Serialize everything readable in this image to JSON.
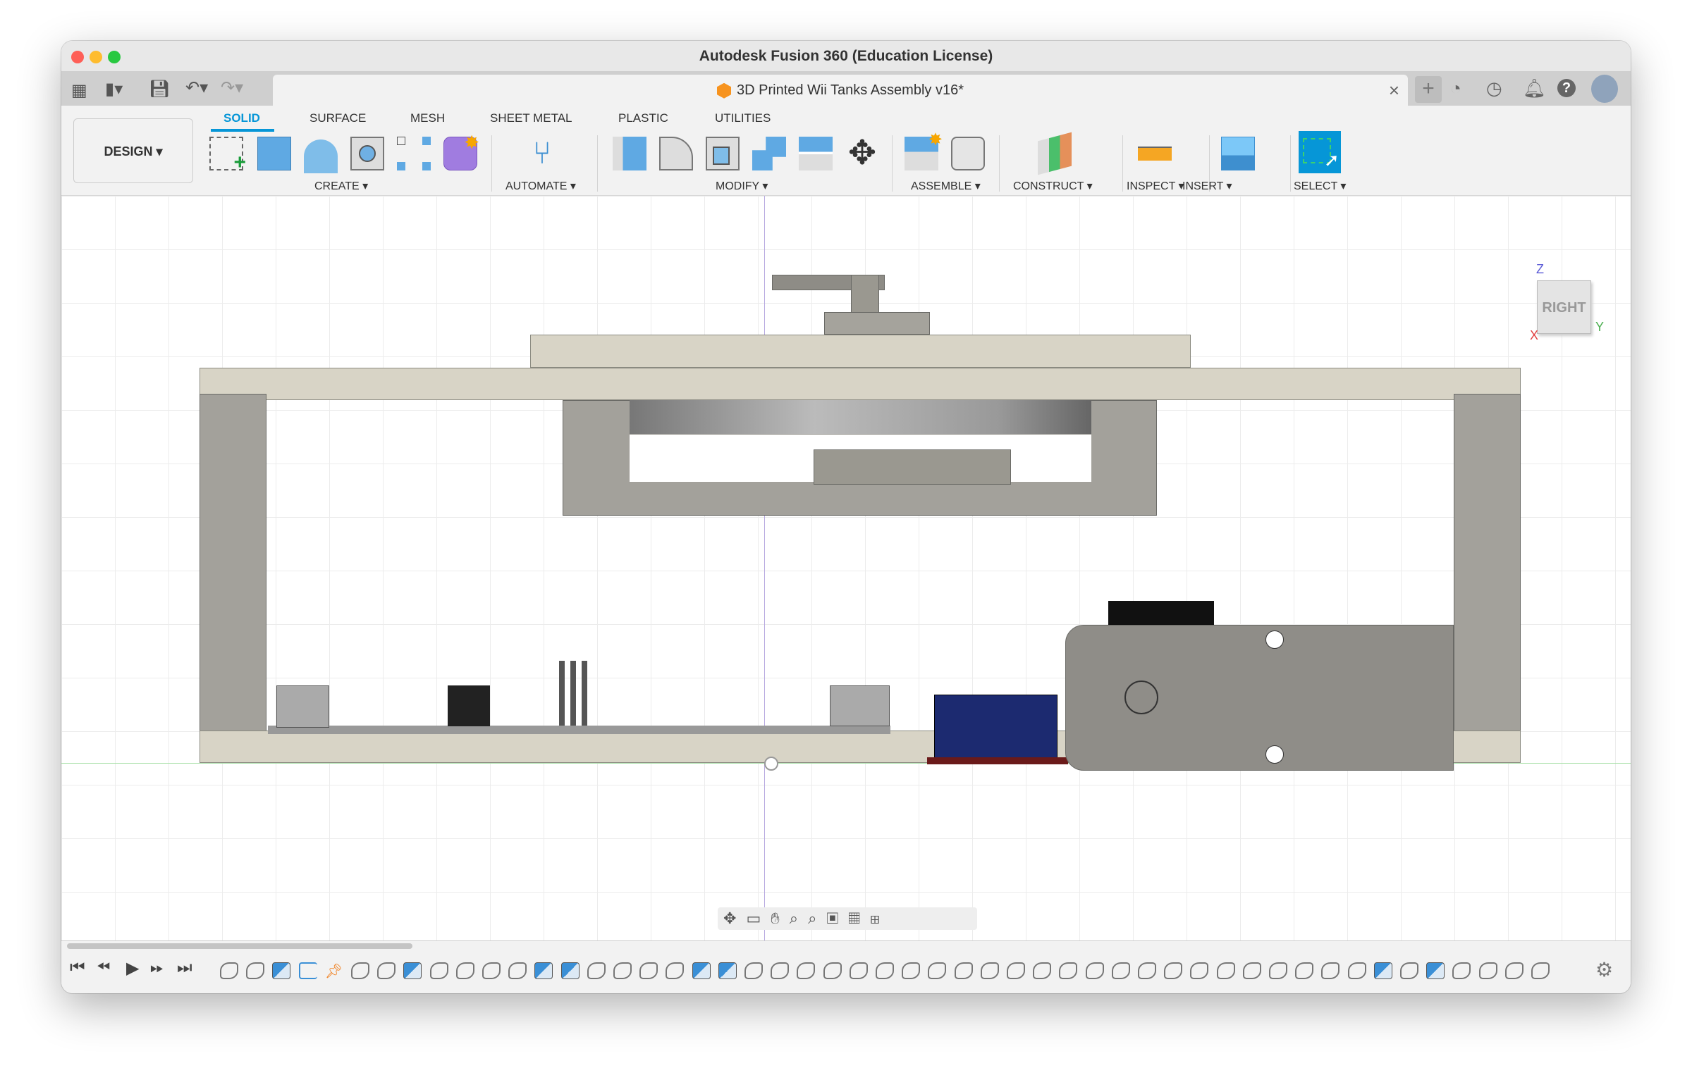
{
  "window": {
    "title": "Autodesk Fusion 360 (Education License)"
  },
  "document_tab": {
    "title": "3D Printed Wii Tanks Assembly v16*",
    "close": "×"
  },
  "workspace": {
    "label": "DESIGN ▾"
  },
  "toolbar_tabs": [
    {
      "label": "SOLID",
      "active": true
    },
    {
      "label": "SURFACE"
    },
    {
      "label": "MESH"
    },
    {
      "label": "SHEET METAL"
    },
    {
      "label": "PLASTIC"
    },
    {
      "label": "UTILITIES"
    }
  ],
  "groups": {
    "create": "CREATE ▾",
    "automate": "AUTOMATE ▾",
    "modify": "MODIFY ▾",
    "assemble": "ASSEMBLE ▾",
    "construct": "CONSTRUCT ▾",
    "inspect": "INSPECT ▾",
    "insert": "INSERT ▾",
    "select": "SELECT ▾"
  },
  "viewcube": {
    "face": "RIGHT",
    "axis_z": "Z",
    "axis_x": "X",
    "axis_y": "Y"
  },
  "colors": {
    "accent": "#0696d7",
    "part": "#d8d4c6",
    "select": "#0696d7"
  },
  "timeline": {
    "features": [
      "joint",
      "joint",
      "sketch",
      "plane",
      "pin",
      "joint",
      "joint",
      "sketch",
      "joint",
      "joint",
      "joint",
      "joint",
      "sketch",
      "sketch",
      "joint",
      "joint",
      "joint",
      "joint",
      "sketch",
      "sketch",
      "joint",
      "joint",
      "joint",
      "joint",
      "joint",
      "joint",
      "joint",
      "joint",
      "joint",
      "joint",
      "joint",
      "joint",
      "joint",
      "joint",
      "joint",
      "joint",
      "joint",
      "joint",
      "joint",
      "joint",
      "joint",
      "joint",
      "joint",
      "joint",
      "sketch",
      "joint",
      "sketch",
      "joint",
      "joint",
      "joint",
      "joint"
    ]
  }
}
